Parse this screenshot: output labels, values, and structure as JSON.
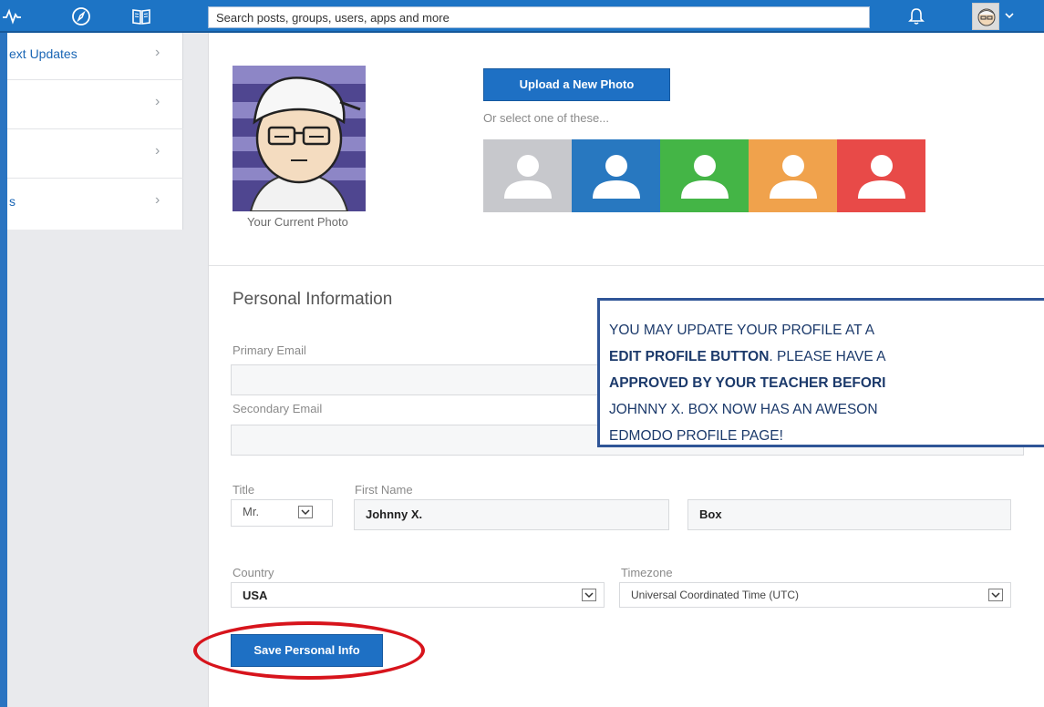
{
  "topbar": {
    "search_placeholder": "Search posts, groups, users, apps and more"
  },
  "sidebar": {
    "items": [
      {
        "label": "ext Updates"
      },
      {
        "label": ""
      },
      {
        "label": ""
      },
      {
        "label": "s"
      }
    ]
  },
  "photo": {
    "current_label": "Your Current Photo",
    "upload_label": "Upload a New Photo",
    "or_select": "Or select one of these...",
    "default_avatar_colors": [
      "#c7c8cc",
      "#2878c0",
      "#44b546",
      "#f0a24c",
      "#e84a48"
    ]
  },
  "personal": {
    "title": "Personal Information",
    "primary_email_label": "Primary Email",
    "primary_email_value": "",
    "secondary_email_label": "Secondary Email",
    "secondary_email_value": "",
    "title_label": "Title",
    "title_value": "Mr.",
    "first_name_label": "First Name",
    "first_name_value": "Johnny X.",
    "last_name_value": "Box",
    "country_label": "Country",
    "country_value": "USA",
    "timezone_label": "Timezone",
    "timezone_value": "Universal Coordinated Time (UTC)",
    "save_label": "Save Personal Info"
  },
  "callout": {
    "line1": "YOU MAY UPDATE YOUR PROFILE AT A",
    "line2_bold": "EDIT PROFILE BUTTON",
    "line2_rest": ". PLEASE HAVE A",
    "line3_bold": "APPROVED BY YOUR TEACHER BEFORI",
    "line4": "JOHNNY X. BOX NOW HAS AN AWESON",
    "line5": "EDMODO PROFILE PAGE!"
  },
  "colors": {
    "brand": "#1d74c5",
    "button": "#1e70c4",
    "highlight": "#d7141c",
    "callout_border": "#2f5597"
  }
}
